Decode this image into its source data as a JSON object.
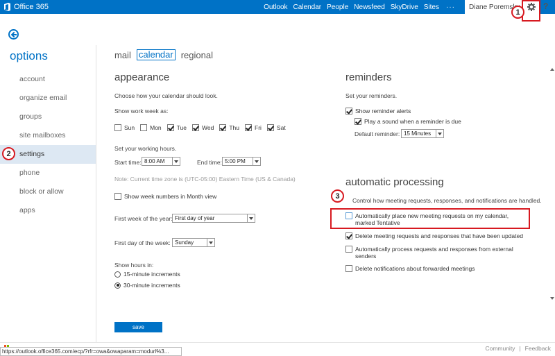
{
  "app": {
    "brand": "Office 365"
  },
  "topnav": [
    "Outlook",
    "Calendar",
    "People",
    "Newsfeed",
    "SkyDrive",
    "Sites"
  ],
  "more": "···",
  "user": "Diane Poremsky",
  "help": "?",
  "callouts": {
    "c1": "1",
    "c2": "2",
    "c3": "3"
  },
  "options_title": "options",
  "leftnav": [
    "account",
    "organize email",
    "groups",
    "site mailboxes",
    "settings",
    "phone",
    "block or allow",
    "apps"
  ],
  "tabs": [
    "mail",
    "calendar",
    "regional"
  ],
  "appearance": {
    "title": "appearance",
    "desc": "Choose how your calendar should look.",
    "workweek_label": "Show work week as:",
    "days": [
      {
        "label": "Sun",
        "checked": false
      },
      {
        "label": "Mon",
        "checked": false
      },
      {
        "label": "Tue",
        "checked": true
      },
      {
        "label": "Wed",
        "checked": true
      },
      {
        "label": "Thu",
        "checked": true
      },
      {
        "label": "Fri",
        "checked": true
      },
      {
        "label": "Sat",
        "checked": true
      }
    ],
    "hours_label": "Set your working hours.",
    "start_label": "Start time:",
    "start_value": "8:00 AM",
    "end_label": "End time:",
    "end_value": "5:00 PM",
    "note": "Note: Current time zone is (UTC-05:00) Eastern Time (US & Canada)",
    "week_numbers": "Show week numbers in Month view",
    "first_week_label": "First week of the year:",
    "first_week_value": "First day of year",
    "first_day_label": "First day of the week:",
    "first_day_value": "Sunday",
    "show_hours_label": "Show hours in:",
    "inc15": "15-minute increments",
    "inc30": "30-minute increments"
  },
  "save_label": "save",
  "reminders": {
    "title": "reminders",
    "desc": "Set your reminders.",
    "show_alerts": "Show reminder alerts",
    "play_sound": "Play a sound when a reminder is due",
    "default_label": "Default reminder:",
    "default_value": "15 Minutes"
  },
  "processing": {
    "title": "automatic processing",
    "desc": "Control how meeting requests, responses, and notifications are handled.",
    "auto_place_1": "Automatically place new meeting requests on my calendar,",
    "auto_place_2": "marked Tentative",
    "delete_updated": "Delete meeting requests and responses that have been updated",
    "auto_process_1": "Automatically process requests and responses from external",
    "auto_process_2": "senders",
    "delete_forwarded": "Delete notifications about forwarded meetings"
  },
  "footer": {
    "community": "Community",
    "sep": "|",
    "feedback": "Feedback"
  },
  "status_url": "https://outlook.office365.com/ecp/?rfr=owa&owaparam=modurl%3...",
  "colors": {
    "brand": "#0072c6",
    "callout": "#d71920",
    "active_nav": "#dde8f3"
  }
}
